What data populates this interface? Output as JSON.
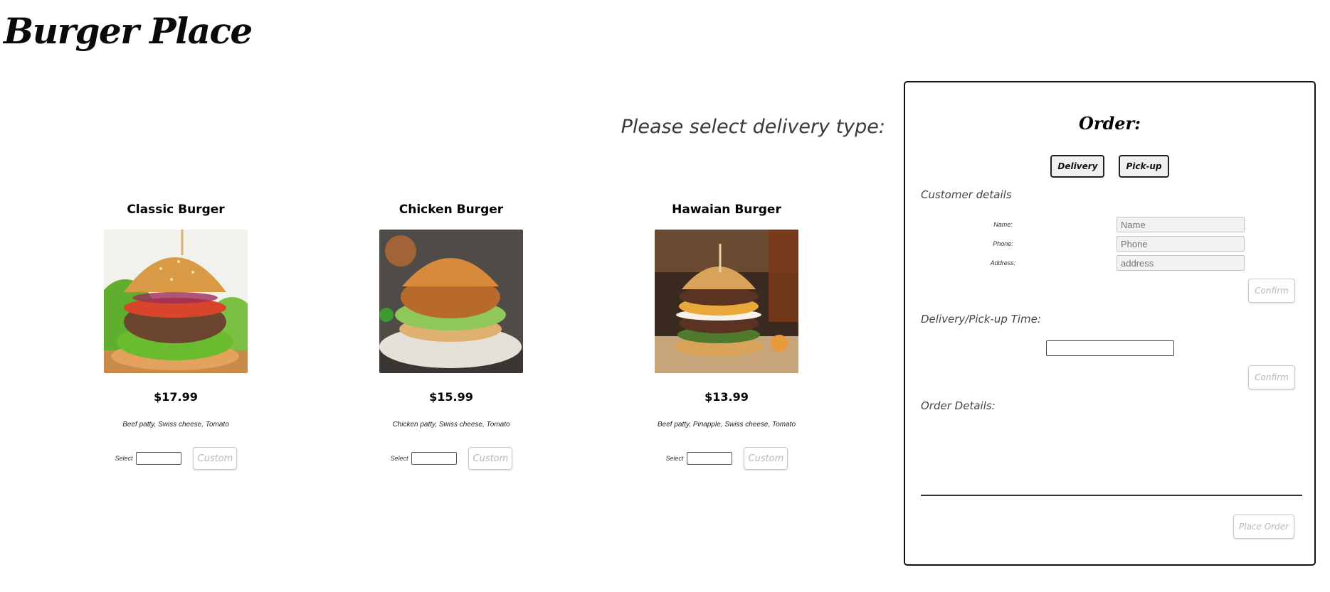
{
  "site": {
    "brand": "Burger Place"
  },
  "delivery_prompt": "Please select delivery type:",
  "menu": [
    {
      "name": "Classic Burger",
      "price": "$17.99",
      "description": "Beef patty, Swiss cheese, Tomato",
      "select_label": "Select",
      "custom_label": "Custom",
      "image": "classic-burger-photo"
    },
    {
      "name": "Chicken Burger",
      "price": "$15.99",
      "description": "Chicken patty, Swiss cheese, Tomato",
      "select_label": "Select",
      "custom_label": "Custom",
      "image": "chicken-burger-photo"
    },
    {
      "name": "Hawaian Burger",
      "price": "$13.99",
      "description": "Beef patty, Pinapple, Swiss cheese, Tomato",
      "select_label": "Select",
      "custom_label": "Custom",
      "image": "hawaian-burger-photo"
    }
  ],
  "order": {
    "title": "Order:",
    "delivery_button": "Delivery",
    "pickup_button": "Pick-up",
    "customer_details_label": "Customer details",
    "fields": [
      {
        "label": "Name:",
        "placeholder": "Name"
      },
      {
        "label": "Phone:",
        "placeholder": "Phone"
      },
      {
        "label": "Address:",
        "placeholder": "address"
      }
    ],
    "confirm_label": "Confirm",
    "time_label": "Delivery/Pick-up Time:",
    "details_label": "Order Details:",
    "place_order_label": "Place Order"
  }
}
